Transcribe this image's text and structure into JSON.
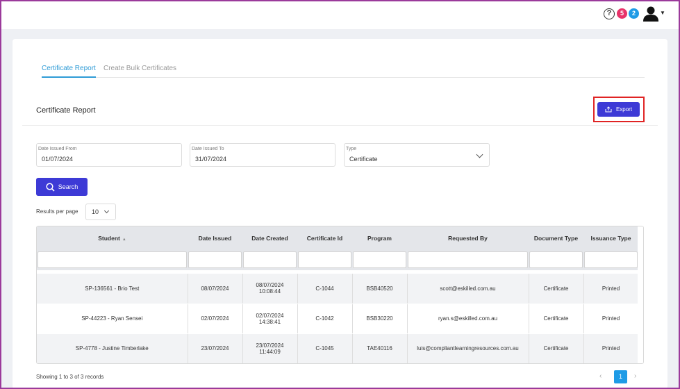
{
  "header": {
    "help_label": "?",
    "notif_count_red": "5",
    "notif_count_blue": "2"
  },
  "tabs": [
    {
      "label": "Certificate Report",
      "active": true
    },
    {
      "label": "Create Bulk Certificates",
      "active": false
    }
  ],
  "page_title": "Certificate Report",
  "export_label": "Export",
  "filters": {
    "date_from": {
      "label": "Date Issued From",
      "value": "01/07/2024"
    },
    "date_to": {
      "label": "Date Issued To",
      "value": "31/07/2024"
    },
    "type": {
      "label": "Type",
      "value": "Certificate"
    }
  },
  "search_label": "Search",
  "results_per_page": {
    "label": "Results per page",
    "value": "10"
  },
  "table": {
    "columns": [
      "Student",
      "Date Issued",
      "Date Created",
      "Certificate Id",
      "Program",
      "Requested By",
      "Document Type",
      "Issuance Type"
    ],
    "rows": [
      {
        "student": "SP-136561 - Brio Test",
        "date_issued": "08/07/2024",
        "date_created_date": "08/07/2024",
        "date_created_time": "10:08:44",
        "certificate_id": "C-1044",
        "program": "BSB40520",
        "requested_by": "scott@eskilled.com.au",
        "document_type": "Certificate",
        "issuance_type": "Printed"
      },
      {
        "student": "SP-44223 - Ryan Sensei",
        "date_issued": "02/07/2024",
        "date_created_date": "02/07/2024",
        "date_created_time": "14:38:41",
        "certificate_id": "C-1042",
        "program": "BSB30220",
        "requested_by": "ryan.s@eskilled.com.au",
        "document_type": "Certificate",
        "issuance_type": "Printed"
      },
      {
        "student": "SP-4778 - Justine Timberlake",
        "date_issued": "23/07/2024",
        "date_created_date": "23/07/2024",
        "date_created_time": "11:44:09",
        "certificate_id": "C-1045",
        "program": "TAE40116",
        "requested_by": "luis@compliantlearningresources.com.au",
        "document_type": "Certificate",
        "issuance_type": "Printed"
      }
    ]
  },
  "footer": {
    "showing": "Showing 1 to 3 of 3 records",
    "current_page": "1"
  },
  "colors": {
    "primary": "#3d3ad6",
    "accent": "#1e9be6",
    "highlight": "#e02424"
  }
}
